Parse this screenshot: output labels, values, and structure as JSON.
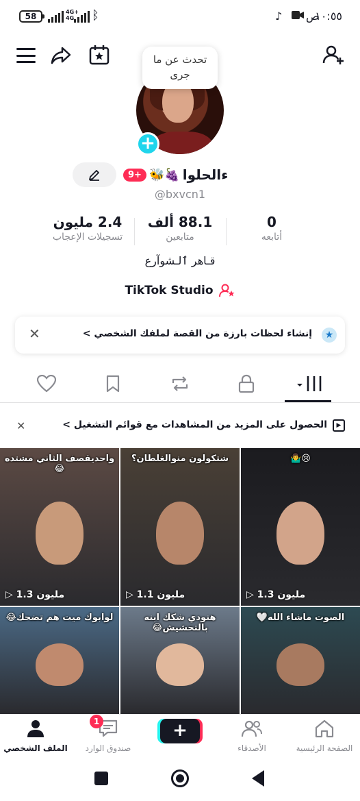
{
  "status_bar": {
    "battery": "58",
    "network": "4G+",
    "network_sub": "4G",
    "time": "١٠:٥٥",
    "ampm": "ص"
  },
  "header": {
    "bubble_text": "تحدث عن ما جرى"
  },
  "profile": {
    "display_name": "ءالحلوا",
    "emojis": "🐝🍇",
    "notif_badge": "9+",
    "handle": "@bxvcn1",
    "bio": "قـاهر ٱلـشوآرع",
    "studio_label": "TikTok Studio"
  },
  "stats": {
    "following_value": "0",
    "following_label": "أتابعه",
    "followers_value": "88.1 ألف",
    "followers_label": "متابعين",
    "likes_value": "2.4 مليون",
    "likes_label": "تسجيلات الإعجاب"
  },
  "promo": {
    "text": "إنشاء لحظات بارزة من القصة لملفك الشخصي >"
  },
  "playlist_banner": {
    "text": "الحصول على المزيد من المشاهدات مع قوائم التشغيل >"
  },
  "videos": [
    {
      "caption": "😢🤷‍♂️",
      "views": "1.3 مليون",
      "bg": "#1b1b1f"
    },
    {
      "caption": "شتكولون منوالغلطان؟",
      "views": "1.1 مليون",
      "bg": "#4a4036"
    },
    {
      "caption": "واحديقصف الثاني مشتده😂",
      "views": "1.3 مليون",
      "bg": "#5c4a44"
    },
    {
      "caption": "الصوت ماشاء الله🤍",
      "views": "",
      "bg": "#2d4a52"
    },
    {
      "caption": "هنودي شكك ابنه بالتحشيش😂",
      "views": "",
      "bg": "#6c7a8a"
    },
    {
      "caption": "لوابوك ميت هم تضحك😂",
      "views": "",
      "bg": "#4b6a86"
    }
  ],
  "bottom_nav": {
    "home": "الصفحة الرئيسية",
    "friends": "الأصدقاء",
    "inbox": "صندوق الوارد",
    "inbox_badge": "1",
    "profile": "الملف الشخصي"
  }
}
